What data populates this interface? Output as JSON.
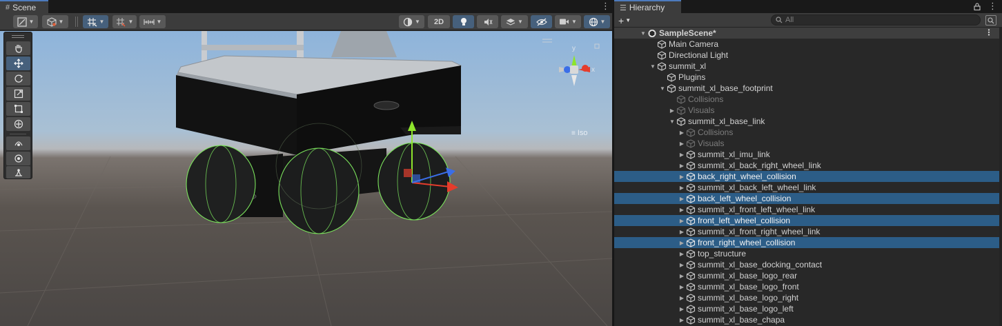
{
  "scene_tab": {
    "title": "Scene"
  },
  "scene_toolbar": {
    "mode_2d": "2D",
    "buttons": [
      "draw-mode",
      "render-mode",
      "grid-snap",
      "increment-snap",
      "ruler",
      "shading",
      "2d",
      "lighting",
      "audio",
      "effects",
      "visibility",
      "camera",
      "gizmos"
    ]
  },
  "tools": [
    "View",
    "Move",
    "Rotate",
    "Scale",
    "Rect",
    "Transform",
    "Custom 1",
    "Custom 2",
    "Pivot"
  ],
  "gizmo": {
    "axis_x": "x",
    "axis_y": "y",
    "view_label": "Iso"
  },
  "hierarchy_tab": {
    "title": "Hierarchy"
  },
  "hierarchy_toolbar": {
    "add_label": "+",
    "search_placeholder": "All"
  },
  "tree": [
    {
      "label": "SampleScene*",
      "depth": 0,
      "arrow": "expanded",
      "type": "scene"
    },
    {
      "label": "Main Camera",
      "depth": 1,
      "arrow": "none"
    },
    {
      "label": "Directional Light",
      "depth": 1,
      "arrow": "none"
    },
    {
      "label": "summit_xl",
      "depth": 1,
      "arrow": "expanded"
    },
    {
      "label": "Plugins",
      "depth": 2,
      "arrow": "none"
    },
    {
      "label": "summit_xl_base_footprint",
      "depth": 2,
      "arrow": "expanded"
    },
    {
      "label": "Collisions",
      "depth": 3,
      "arrow": "none",
      "dim": true
    },
    {
      "label": "Visuals",
      "depth": 3,
      "arrow": "collapsed",
      "dim": true
    },
    {
      "label": "summit_xl_base_link",
      "depth": 3,
      "arrow": "expanded"
    },
    {
      "label": "Collisions",
      "depth": 4,
      "arrow": "collapsed",
      "dim": true
    },
    {
      "label": "Visuals",
      "depth": 4,
      "arrow": "collapsed",
      "dim": true
    },
    {
      "label": "summit_xl_imu_link",
      "depth": 4,
      "arrow": "collapsed"
    },
    {
      "label": "summit_xl_back_right_wheel_link",
      "depth": 4,
      "arrow": "collapsed"
    },
    {
      "label": "back_right_wheel_collision",
      "depth": 4,
      "arrow": "collapsed",
      "selected": true
    },
    {
      "label": "summit_xl_back_left_wheel_link",
      "depth": 4,
      "arrow": "collapsed"
    },
    {
      "label": "back_left_wheel_collision",
      "depth": 4,
      "arrow": "collapsed",
      "selected": true
    },
    {
      "label": "summit_xl_front_left_wheel_link",
      "depth": 4,
      "arrow": "collapsed"
    },
    {
      "label": "front_left_wheel_collision",
      "depth": 4,
      "arrow": "collapsed",
      "selected": true
    },
    {
      "label": "summit_xl_front_right_wheel_link",
      "depth": 4,
      "arrow": "collapsed"
    },
    {
      "label": "front_right_wheel_collision",
      "depth": 4,
      "arrow": "collapsed",
      "selected": true
    },
    {
      "label": "top_structure",
      "depth": 4,
      "arrow": "collapsed"
    },
    {
      "label": "summit_xl_base_docking_contact",
      "depth": 4,
      "arrow": "collapsed"
    },
    {
      "label": "summit_xl_base_logo_rear",
      "depth": 4,
      "arrow": "collapsed"
    },
    {
      "label": "summit_xl_base_logo_front",
      "depth": 4,
      "arrow": "collapsed"
    },
    {
      "label": "summit_xl_base_logo_right",
      "depth": 4,
      "arrow": "collapsed"
    },
    {
      "label": "summit_xl_base_logo_left",
      "depth": 4,
      "arrow": "collapsed"
    },
    {
      "label": "summit_xl_base_chapa",
      "depth": 4,
      "arrow": "collapsed"
    }
  ],
  "colors": {
    "selection": "#2c5d87",
    "active_button": "#46607c",
    "collider_green": "#7be35c",
    "axis_x": "#e53c2c",
    "axis_y": "#8ee52c",
    "axis_z": "#3a6ee8"
  }
}
